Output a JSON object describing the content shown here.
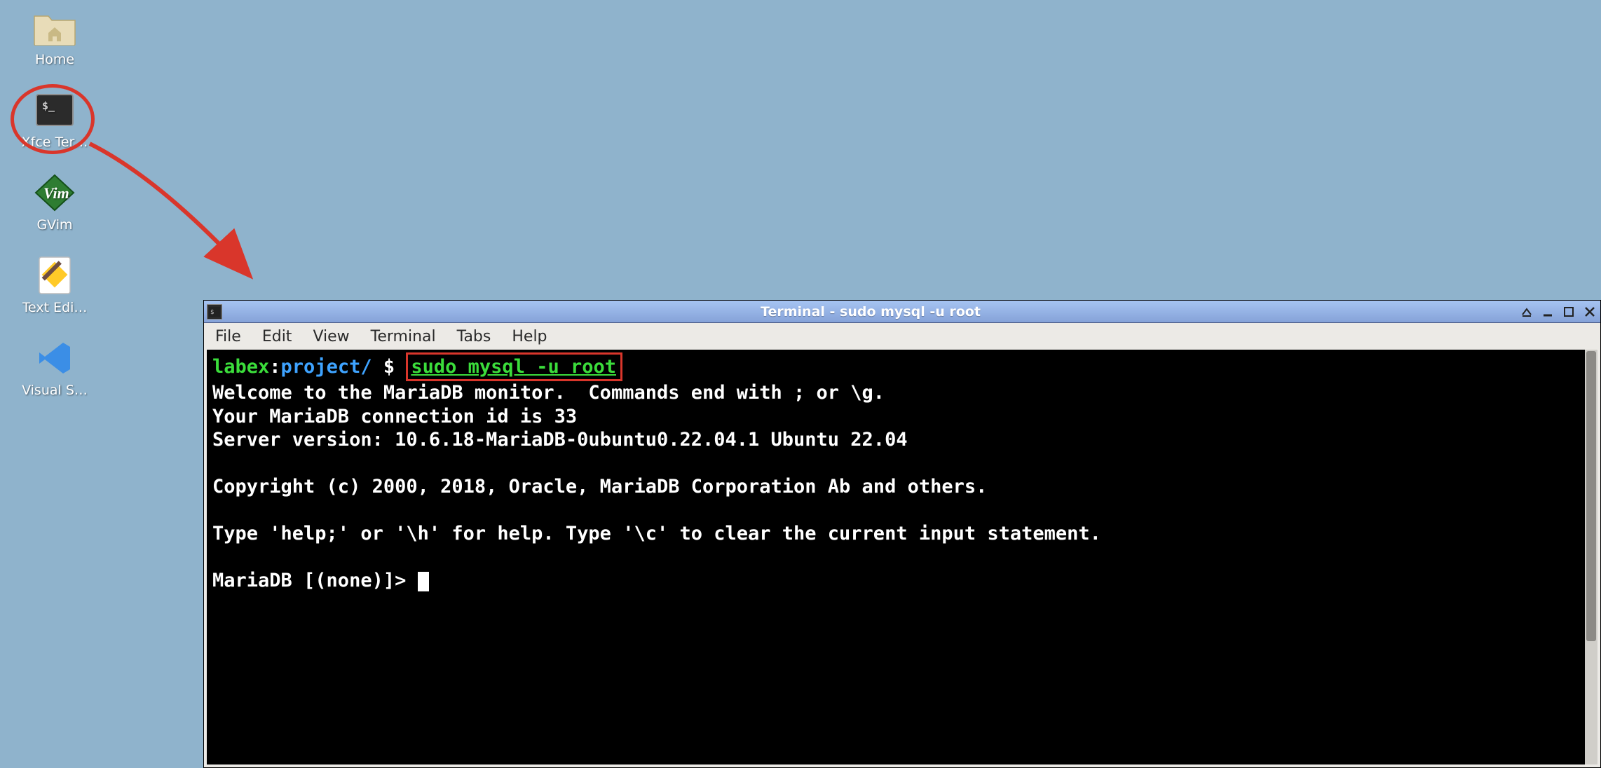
{
  "desktop": {
    "icons": [
      {
        "label": "Home"
      },
      {
        "label": "Xfce Ter…"
      },
      {
        "label": "GVim"
      },
      {
        "label": "Text Edi…"
      },
      {
        "label": "Visual S…"
      }
    ]
  },
  "window": {
    "title": "Terminal - sudo mysql -u root",
    "menu": [
      "File",
      "Edit",
      "View",
      "Terminal",
      "Tabs",
      "Help"
    ]
  },
  "terminal": {
    "prompt_host": "labex",
    "prompt_path": "project/",
    "prompt_symbol": "$",
    "command": "sudo mysql -u root",
    "welcome_l1": "Welcome to the MariaDB monitor.  Commands end with ; or \\g.",
    "welcome_l2": "Your MariaDB connection id is 33",
    "welcome_l3": "Server version: 10.6.18-MariaDB-0ubuntu0.22.04.1 Ubuntu 22.04",
    "copyright": "Copyright (c) 2000, 2018, Oracle, MariaDB Corporation Ab and others.",
    "help_line": "Type 'help;' or '\\h' for help. Type '\\c' to clear the current input statement.",
    "db_prompt": "MariaDB [(none)]> "
  }
}
